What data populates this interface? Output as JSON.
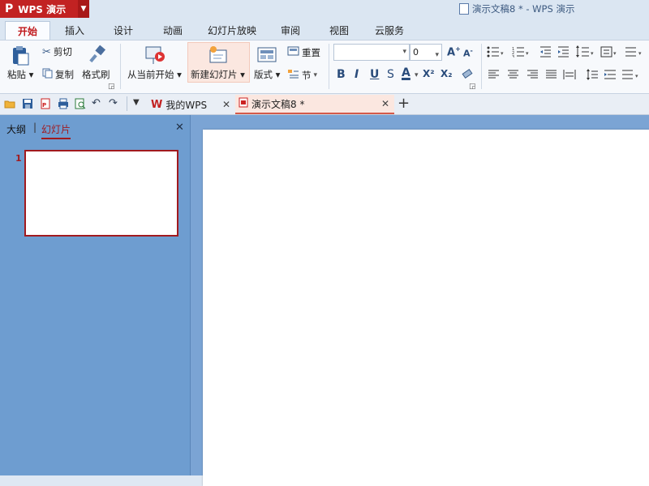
{
  "app": {
    "name": "WPS 演示",
    "logo": "P",
    "window_title": "演示文稿8 * - WPS 演示"
  },
  "tabs": [
    "开始",
    "插入",
    "设计",
    "动画",
    "幻灯片放映",
    "审阅",
    "视图",
    "云服务"
  ],
  "clipboard": {
    "paste": "粘贴",
    "cut": "剪切",
    "copy": "复制",
    "format_painter": "格式刷"
  },
  "slides": {
    "from_current": "从当前开始",
    "new_slide": "新建幻灯片",
    "layout": "版式",
    "reset": "重置",
    "section": "节"
  },
  "font": {
    "name_value": "",
    "size_value": "0"
  },
  "format_buttons": [
    "B",
    "I",
    "U",
    "S",
    "A",
    "X²",
    "X₂"
  ],
  "doc_tabs": {
    "mywps": "我的WPS",
    "current": "演示文稿8 *"
  },
  "left_pane": {
    "outline_tab": "大纲",
    "slides_tab": "幻灯片",
    "slide_number": "1"
  },
  "colors": {
    "accent_red": "#c22222",
    "pane_blue": "#6e9dd0"
  }
}
